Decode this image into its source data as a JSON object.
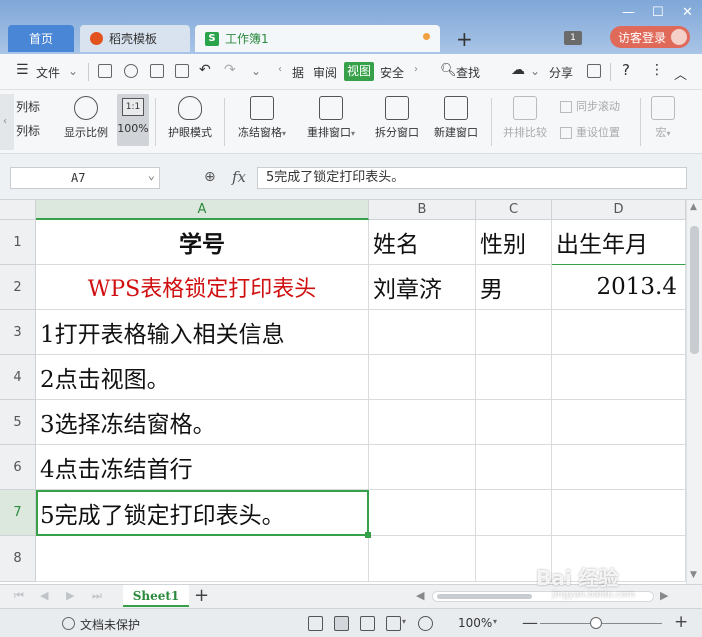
{
  "tabs": {
    "home": "首页",
    "template": "稻壳模板",
    "workbook": "工作簿1",
    "add": "+"
  },
  "window": {
    "minimize": "—",
    "maximize": "☐",
    "close": "✕"
  },
  "header": {
    "badge": "1",
    "login": "访客登录"
  },
  "menu": {
    "file": "文件",
    "data_partial": "据",
    "review": "审阅",
    "view": "视图",
    "security": "安全",
    "search": "查找",
    "share": "分享",
    "help": "?",
    "more": "⋮",
    "collapse": "︿"
  },
  "ribbon": {
    "left_partial_1": "列标",
    "left_partial_2": "列标",
    "display_ratio": "显示比例",
    "hundred_pct": "100%",
    "ratio_label": "1:1",
    "eye_mode": "护眼模式",
    "freeze_pane": "冻结窗格",
    "rearrange_window": "重排窗口",
    "split_window": "拆分窗口",
    "new_window": "新建窗口",
    "side_by_side": "并排比较",
    "sync_scroll": "同步滚动",
    "reset_position": "重设位置",
    "macro": "宏"
  },
  "formula_bar": {
    "cell_ref": "A7",
    "fx": "fx",
    "content": "5完成了锁定打印表头。"
  },
  "grid": {
    "columns": [
      "A",
      "B",
      "C",
      "D"
    ],
    "rows": [
      "1",
      "2",
      "3",
      "4",
      "5",
      "6",
      "7",
      "8"
    ],
    "cells": {
      "A1": "学号",
      "B1": "姓名",
      "C1": "性别",
      "D1": "出生年月",
      "A2": "WPS表格锁定打印表头",
      "B2": "刘章济",
      "C2": "男",
      "D2": "2013.4",
      "A3": "1打开表格输入相关信息",
      "A4": "2点击视图。",
      "A5": "3选择冻结窗格。",
      "A6": "4点击冻结首行",
      "A7": "5完成了锁定打印表头。"
    }
  },
  "sheets": {
    "active": "Sheet1",
    "add": "+"
  },
  "status": {
    "protect": "文档未保护",
    "zoom": "100%",
    "zoom_minus": "—",
    "zoom_plus": "+"
  },
  "watermark": {
    "text": "Bai 经验",
    "url": "jingyan.baidu.com"
  },
  "colors": {
    "accent": "#36a149",
    "title_red": "#d01010",
    "tab_blue": "#4a86d6"
  }
}
